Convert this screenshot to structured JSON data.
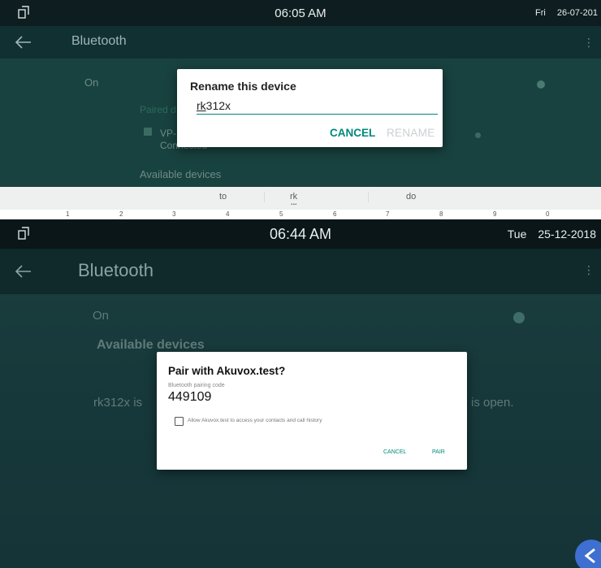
{
  "top": {
    "status": {
      "time": "06:05 AM",
      "day": "Fri",
      "date": "26-07-201"
    },
    "appbar": {
      "title": "Bluetooth"
    },
    "background": {
      "on_label": "On",
      "paired_label": "Paired d",
      "device_name": "VP-R",
      "device_status": "Connected",
      "available_label": "Available devices"
    },
    "dialog": {
      "title": "Rename this device",
      "input_value": "rk312x",
      "input_value_underlined": "rk",
      "input_value_rest": "312x",
      "cancel": "CANCEL",
      "rename": "RENAME"
    },
    "keyboard": {
      "suggestions": [
        "to",
        "rk",
        "do"
      ],
      "suggestion_more": "...",
      "number_row": [
        "1",
        "2",
        "3",
        "4",
        "5",
        "6",
        "7",
        "8",
        "9",
        "0"
      ]
    }
  },
  "bottom": {
    "status": {
      "time": "06:44 AM",
      "day": "Tue",
      "date": "25-12-2018"
    },
    "appbar": {
      "title": "Bluetooth"
    },
    "background": {
      "on_label": "On",
      "available_label": "Available devices",
      "visible_text_left": "rk312x is",
      "visible_text_right": "is open."
    },
    "dialog": {
      "title": "Pair with Akuvox.test?",
      "subtitle": "Bluetooth pairing code",
      "code": "449109",
      "checkbox_label": "Allow Akuvox.test to access your contacts and call history",
      "checkbox_checked": false,
      "cancel": "CANCEL",
      "pair": "PAIR"
    }
  },
  "colors": {
    "accent": "#00897b",
    "status_bar": "#0e1d1f",
    "fab": "#3e6fd1"
  }
}
